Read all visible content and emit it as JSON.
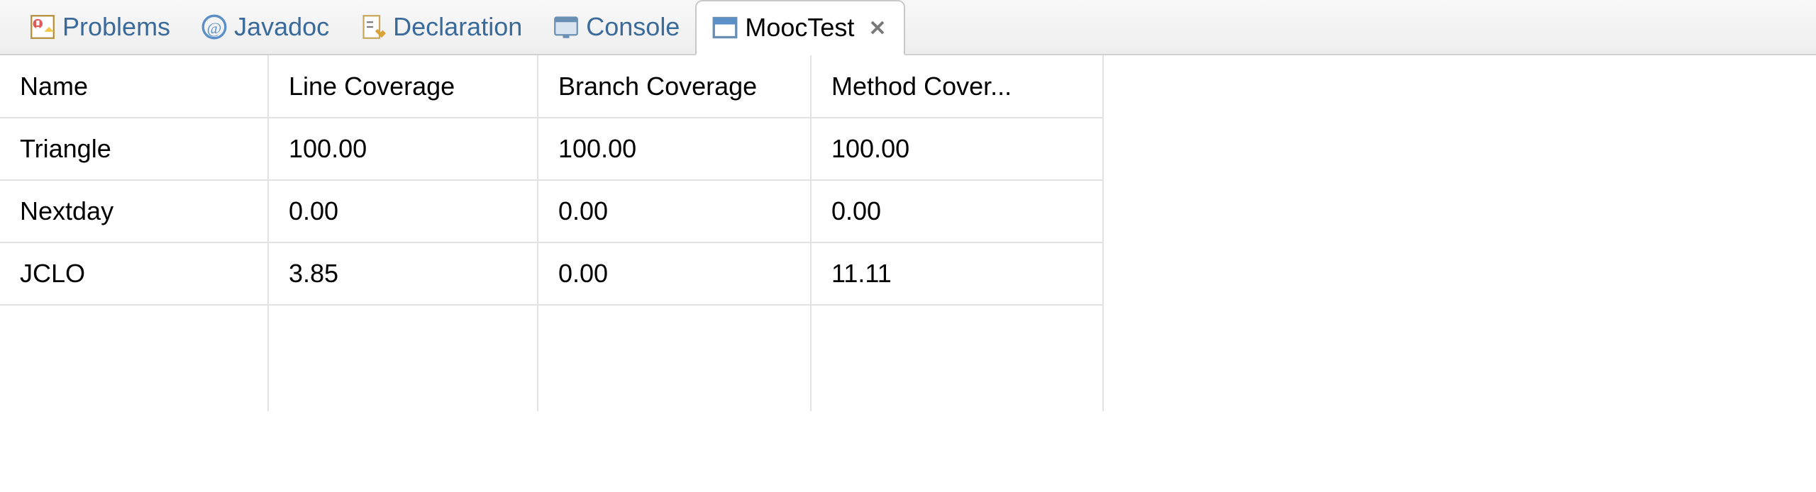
{
  "tabs": [
    {
      "label": "Problems",
      "icon": "problems-icon",
      "active": false
    },
    {
      "label": "Javadoc",
      "icon": "javadoc-icon",
      "active": false
    },
    {
      "label": "Declaration",
      "icon": "declaration-icon",
      "active": false
    },
    {
      "label": "Console",
      "icon": "console-icon",
      "active": false
    },
    {
      "label": "MoocTest",
      "icon": "mooctest-icon",
      "active": true
    }
  ],
  "table": {
    "headers": [
      "Name",
      "Line Coverage",
      "Branch Coverage",
      "Method Cover..."
    ],
    "rows": [
      {
        "name": "Triangle",
        "line": "100.00",
        "branch": "100.00",
        "method": "100.00"
      },
      {
        "name": "Nextday",
        "line": "0.00",
        "branch": "0.00",
        "method": "0.00"
      },
      {
        "name": "JCLO",
        "line": "3.85",
        "branch": "0.00",
        "method": "11.11"
      }
    ]
  }
}
